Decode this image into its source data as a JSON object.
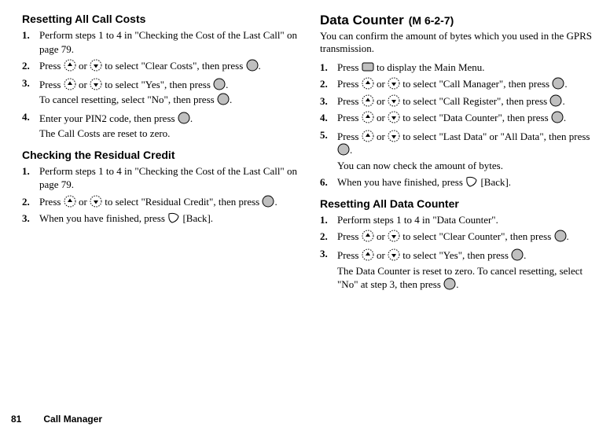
{
  "left": {
    "section1": {
      "heading": "Resetting All Call Costs",
      "steps": [
        [
          {
            "t": "Perform steps 1 to 4 in \"Checking the Cost of the Last Call\" on page 79."
          }
        ],
        [
          {
            "t": "Press "
          },
          {
            "i": "up"
          },
          {
            "t": " or "
          },
          {
            "i": "down"
          },
          {
            "t": " to select \"Clear Costs\", then press "
          },
          {
            "i": "center"
          },
          {
            "t": "."
          }
        ],
        [
          {
            "t": "Press "
          },
          {
            "i": "up"
          },
          {
            "t": " or "
          },
          {
            "i": "down"
          },
          {
            "t": " to select \"Yes\", then press "
          },
          {
            "i": "center"
          },
          {
            "t": "."
          },
          {
            "br": true
          },
          {
            "t": "To cancel resetting, select \"No\", then press "
          },
          {
            "i": "center"
          },
          {
            "t": "."
          }
        ],
        [
          {
            "t": "Enter your PIN2 code, then press "
          },
          {
            "i": "center"
          },
          {
            "t": "."
          },
          {
            "br": true
          },
          {
            "t": "The Call Costs are reset to zero."
          }
        ]
      ]
    },
    "section2": {
      "heading": "Checking the Residual Credit",
      "steps": [
        [
          {
            "t": "Perform steps 1 to 4 in \"Checking the Cost of the Last Call\" on page 79."
          }
        ],
        [
          {
            "t": "Press "
          },
          {
            "i": "up"
          },
          {
            "t": " or "
          },
          {
            "i": "down"
          },
          {
            "t": " to select \"Residual Credit\", then press "
          },
          {
            "i": "center"
          },
          {
            "t": "."
          }
        ],
        [
          {
            "t": "When you have finished, press "
          },
          {
            "i": "soft-right"
          },
          {
            "t": " [Back]."
          }
        ]
      ]
    }
  },
  "right": {
    "section1": {
      "heading": "Data Counter",
      "menu_code": "(M 6-2-7)",
      "intro": "You can confirm the amount of bytes which you used in the GPRS transmission.",
      "steps": [
        [
          {
            "t": "Press "
          },
          {
            "i": "menu"
          },
          {
            "t": " to display the Main Menu."
          }
        ],
        [
          {
            "t": "Press "
          },
          {
            "i": "up"
          },
          {
            "t": " or "
          },
          {
            "i": "down"
          },
          {
            "t": " to select \"Call Manager\", then press "
          },
          {
            "i": "center"
          },
          {
            "t": "."
          }
        ],
        [
          {
            "t": "Press "
          },
          {
            "i": "up"
          },
          {
            "t": " or "
          },
          {
            "i": "down"
          },
          {
            "t": " to select \"Call Register\", then press "
          },
          {
            "i": "center"
          },
          {
            "t": "."
          }
        ],
        [
          {
            "t": "Press "
          },
          {
            "i": "up"
          },
          {
            "t": " or "
          },
          {
            "i": "down"
          },
          {
            "t": " to select \"Data Counter\", then press "
          },
          {
            "i": "center"
          },
          {
            "t": "."
          }
        ],
        [
          {
            "t": "Press "
          },
          {
            "i": "up"
          },
          {
            "t": " or "
          },
          {
            "i": "down"
          },
          {
            "t": " to select \"Last Data\" or \"All Data\", then press "
          },
          {
            "i": "center"
          },
          {
            "t": "."
          },
          {
            "br": true
          },
          {
            "t": "You can now check the amount of bytes."
          }
        ],
        [
          {
            "t": "When you have finished, press "
          },
          {
            "i": "soft-right"
          },
          {
            "t": " [Back]."
          }
        ]
      ]
    },
    "section2": {
      "heading": "Resetting All Data Counter",
      "steps": [
        [
          {
            "t": "Perform steps 1 to 4 in \"Data Counter\"."
          }
        ],
        [
          {
            "t": "Press "
          },
          {
            "i": "up"
          },
          {
            "t": " or "
          },
          {
            "i": "down"
          },
          {
            "t": " to select \"Clear Counter\", then press "
          },
          {
            "i": "center"
          },
          {
            "t": "."
          }
        ],
        [
          {
            "t": "Press "
          },
          {
            "i": "up"
          },
          {
            "t": " or "
          },
          {
            "i": "down"
          },
          {
            "t": " to select \"Yes\", then press "
          },
          {
            "i": "center"
          },
          {
            "t": "."
          },
          {
            "br": true
          },
          {
            "t": "The Data Counter is reset to zero. To cancel resetting, select \"No\" at step 3, then press "
          },
          {
            "i": "center"
          },
          {
            "t": "."
          }
        ]
      ]
    }
  },
  "footer": {
    "page_number": "81",
    "chapter": "Call Manager"
  }
}
